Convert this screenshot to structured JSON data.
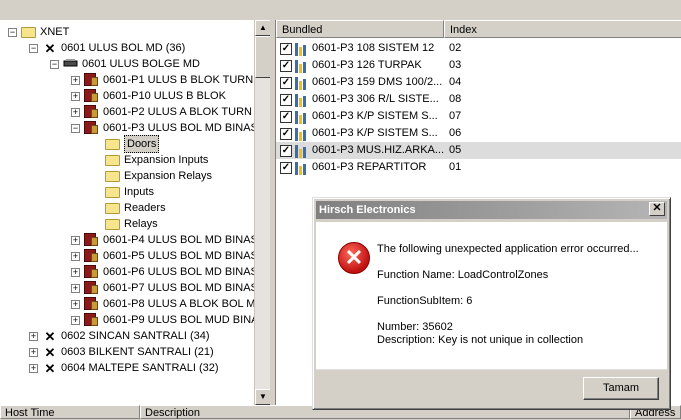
{
  "tree": {
    "items": [
      {
        "label": "XNET",
        "depth": 0,
        "toggle": "-",
        "icon": "folder-icon"
      },
      {
        "label": "0601 ULUS BOL MD (36)",
        "depth": 1,
        "toggle": "-",
        "icon": "network-node-icon"
      },
      {
        "label": "0601 ULUS BOLGE MD",
        "depth": 2,
        "toggle": "-",
        "icon": "controller-icon"
      },
      {
        "label": "0601-P1 ULUS B BLOK TURN",
        "depth": 3,
        "toggle": "+",
        "icon": "panel-icon"
      },
      {
        "label": "0601-P10 ULUS B BLOK",
        "depth": 3,
        "toggle": "+",
        "icon": "panel-icon"
      },
      {
        "label": "0601-P2 ULUS A BLOK TURN",
        "depth": 3,
        "toggle": "+",
        "icon": "panel-icon"
      },
      {
        "label": "0601-P3 ULUS BOL MD BINAS",
        "depth": 3,
        "toggle": "-",
        "icon": "panel-icon"
      },
      {
        "label": "Doors",
        "depth": 4,
        "toggle": "",
        "icon": "folder-open-icon",
        "selected": true
      },
      {
        "label": "Expansion Inputs",
        "depth": 4,
        "toggle": "",
        "icon": "folder-icon"
      },
      {
        "label": "Expansion Relays",
        "depth": 4,
        "toggle": "",
        "icon": "folder-icon"
      },
      {
        "label": "Inputs",
        "depth": 4,
        "toggle": "",
        "icon": "folder-icon"
      },
      {
        "label": "Readers",
        "depth": 4,
        "toggle": "",
        "icon": "folder-icon"
      },
      {
        "label": "Relays",
        "depth": 4,
        "toggle": "",
        "icon": "folder-icon"
      },
      {
        "label": "0601-P4 ULUS BOL MD BINAS",
        "depth": 3,
        "toggle": "+",
        "icon": "panel-icon"
      },
      {
        "label": "0601-P5 ULUS BOL MD BINAS",
        "depth": 3,
        "toggle": "+",
        "icon": "panel-icon"
      },
      {
        "label": "0601-P6 ULUS BOL MD BINAS",
        "depth": 3,
        "toggle": "+",
        "icon": "panel-icon"
      },
      {
        "label": "0601-P7 ULUS BOL MD BINAS",
        "depth": 3,
        "toggle": "+",
        "icon": "panel-icon"
      },
      {
        "label": "0601-P8 ULUS A BLOK  BOL M",
        "depth": 3,
        "toggle": "+",
        "icon": "panel-icon"
      },
      {
        "label": "0601-P9 ULUS BOL MUD BINA",
        "depth": 3,
        "toggle": "+",
        "icon": "panel-icon"
      },
      {
        "label": "0602 SINCAN SANTRALI (34)",
        "depth": 1,
        "toggle": "+",
        "icon": "network-node-icon"
      },
      {
        "label": "0603 BILKENT SANTRALI (21)",
        "depth": 1,
        "toggle": "+",
        "icon": "network-node-icon"
      },
      {
        "label": "0604 MALTEPE SANTRALI (32)",
        "depth": 1,
        "toggle": "+",
        "icon": "network-node-icon"
      }
    ]
  },
  "list": {
    "columns": [
      "Bundled",
      "Index"
    ],
    "rows": [
      {
        "name": "0601-P3 108 SISTEM 12",
        "index": "02",
        "checked": true
      },
      {
        "name": "0601-P3 126 TURPAK",
        "index": "03",
        "checked": true
      },
      {
        "name": "0601-P3 159 DMS 100/2...",
        "index": "04",
        "checked": true
      },
      {
        "name": "0601-P3 306 R/L SISTE...",
        "index": "08",
        "checked": true
      },
      {
        "name": "0601-P3 K/P SISTEM S...",
        "index": "07",
        "checked": true
      },
      {
        "name": "0601-P3 K/P SISTEM S...",
        "index": "06",
        "checked": true
      },
      {
        "name": "0601-P3 MUS.HIZ.ARKA...",
        "index": "05",
        "checked": true,
        "highlighted": true
      },
      {
        "name": "0601-P3 REPARTITOR",
        "index": "01",
        "checked": true
      }
    ]
  },
  "bottom": {
    "columns": [
      "Host Time",
      "Description",
      "Address"
    ]
  },
  "dialog": {
    "title": "Hirsch Electronics",
    "close_glyph": "✕",
    "icon": "error-icon",
    "line1": "The following unexpected application error occurred...",
    "line2": "Function Name: LoadControlZones",
    "line3": "FunctionSubItem: 6",
    "line4": "Number: 35602",
    "line5": "Description: Key is not unique in collection",
    "ok_label": "Tamam"
  }
}
